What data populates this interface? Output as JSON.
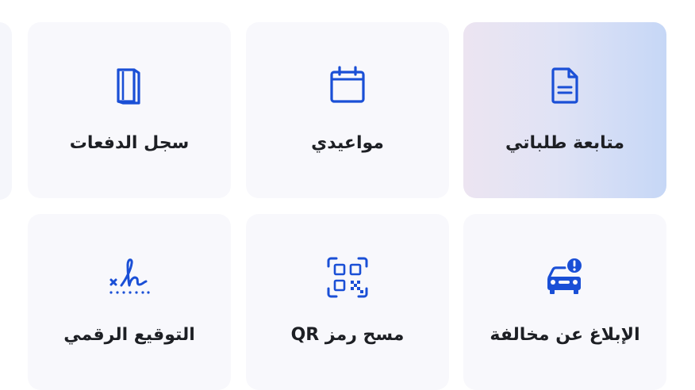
{
  "services": {
    "tracking": {
      "label": "متابعة طلباتي",
      "icon": "document-icon"
    },
    "appointments": {
      "label": "مواعيدي",
      "icon": "calendar-icon"
    },
    "payments": {
      "label": "سجل الدفعات",
      "icon": "book-icon"
    },
    "report": {
      "label": "الإبلاغ عن مخالفة",
      "icon": "car-alert-icon"
    },
    "qr": {
      "label": "مسح رمز QR",
      "icon": "qr-scan-icon"
    },
    "sign": {
      "label": "التوقيع الرقمي",
      "icon": "signature-icon"
    }
  },
  "colors": {
    "icon": "#1a4fd6",
    "card_bg": "#f8f8fc",
    "active_gradient_start": "#ece4f1",
    "active_gradient_end": "#c6d7f6",
    "text": "#1d1f24"
  }
}
